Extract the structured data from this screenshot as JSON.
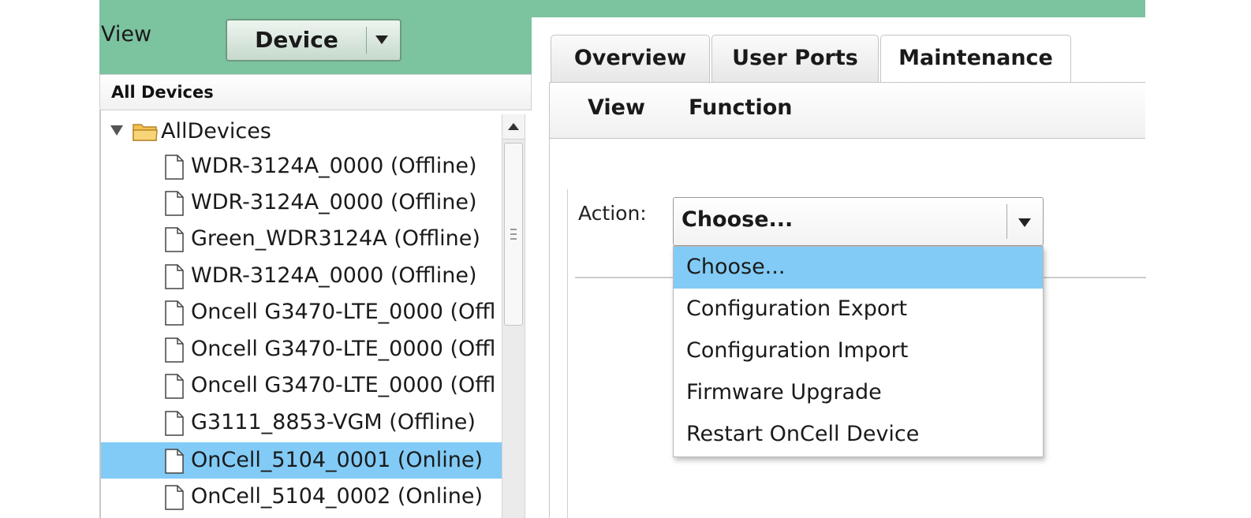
{
  "header": {
    "view_label": "View",
    "view_select": {
      "label": "Device"
    }
  },
  "device_tree": {
    "heading": "All Devices",
    "root": {
      "label": "AllDevices",
      "expanded": true
    },
    "items": [
      {
        "label": "WDR-3124A_0000 (Offline)"
      },
      {
        "label": "WDR-3124A_0000 (Offline)"
      },
      {
        "label": "Green_WDR3124A (Offline)"
      },
      {
        "label": "WDR-3124A_0000 (Offline)"
      },
      {
        "label": "Oncell G3470-LTE_0000 (Offl"
      },
      {
        "label": "Oncell G3470-LTE_0000 (Offl"
      },
      {
        "label": "Oncell G3470-LTE_0000 (Offl"
      },
      {
        "label": "G3111_8853-VGM (Offline)"
      },
      {
        "label": "OnCell_5104_0001 (Online)",
        "selected": true
      },
      {
        "label": "OnCell_5104_0002 (Online)"
      }
    ]
  },
  "tabs": [
    {
      "label": "Overview"
    },
    {
      "label": "User Ports"
    },
    {
      "label": "Maintenance",
      "active": true
    }
  ],
  "subtoolbar": {
    "view": "View",
    "function": "Function"
  },
  "action": {
    "label": "Action:",
    "selected": "Choose...",
    "options": [
      {
        "label": "Choose...",
        "highlighted": true
      },
      {
        "label": "Configuration Export"
      },
      {
        "label": "Configuration Import"
      },
      {
        "label": "Firmware Upgrade"
      },
      {
        "label": "Restart OnCell Device"
      }
    ]
  },
  "colors": {
    "header_green": "#7cc3a0",
    "selection_blue": "#82cbf6"
  }
}
